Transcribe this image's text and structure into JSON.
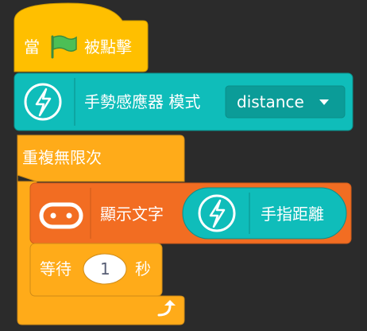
{
  "colors": {
    "background": "#2b2b2b",
    "events": "#FFBF00",
    "events_border": "#CC9900",
    "control": "#FFAB19",
    "control_border": "#CF8B17",
    "extension": "#0FBDBA",
    "extension_border": "#0B8E89",
    "microbit": "#F26D22",
    "microbit_border": "#CC5B1B",
    "flag_green": "#4CBF56"
  },
  "blocks": {
    "when_flag": {
      "prefix": "當",
      "suffix": "被點擊",
      "icon": "green-flag-icon"
    },
    "gesture_mode": {
      "label": "手勢感應器 模式",
      "dropdown_value": "distance",
      "icon": "lightning-icon"
    },
    "forever": {
      "label": "重複無限次",
      "repeat_icon": "loop-arrow-icon"
    },
    "show_text": {
      "label": "顯示文字",
      "icon": "microbit-icon",
      "reporter": {
        "label": "手指距離",
        "icon": "lightning-icon"
      }
    },
    "wait": {
      "prefix": "等待",
      "value": "1",
      "suffix": "秒"
    }
  }
}
